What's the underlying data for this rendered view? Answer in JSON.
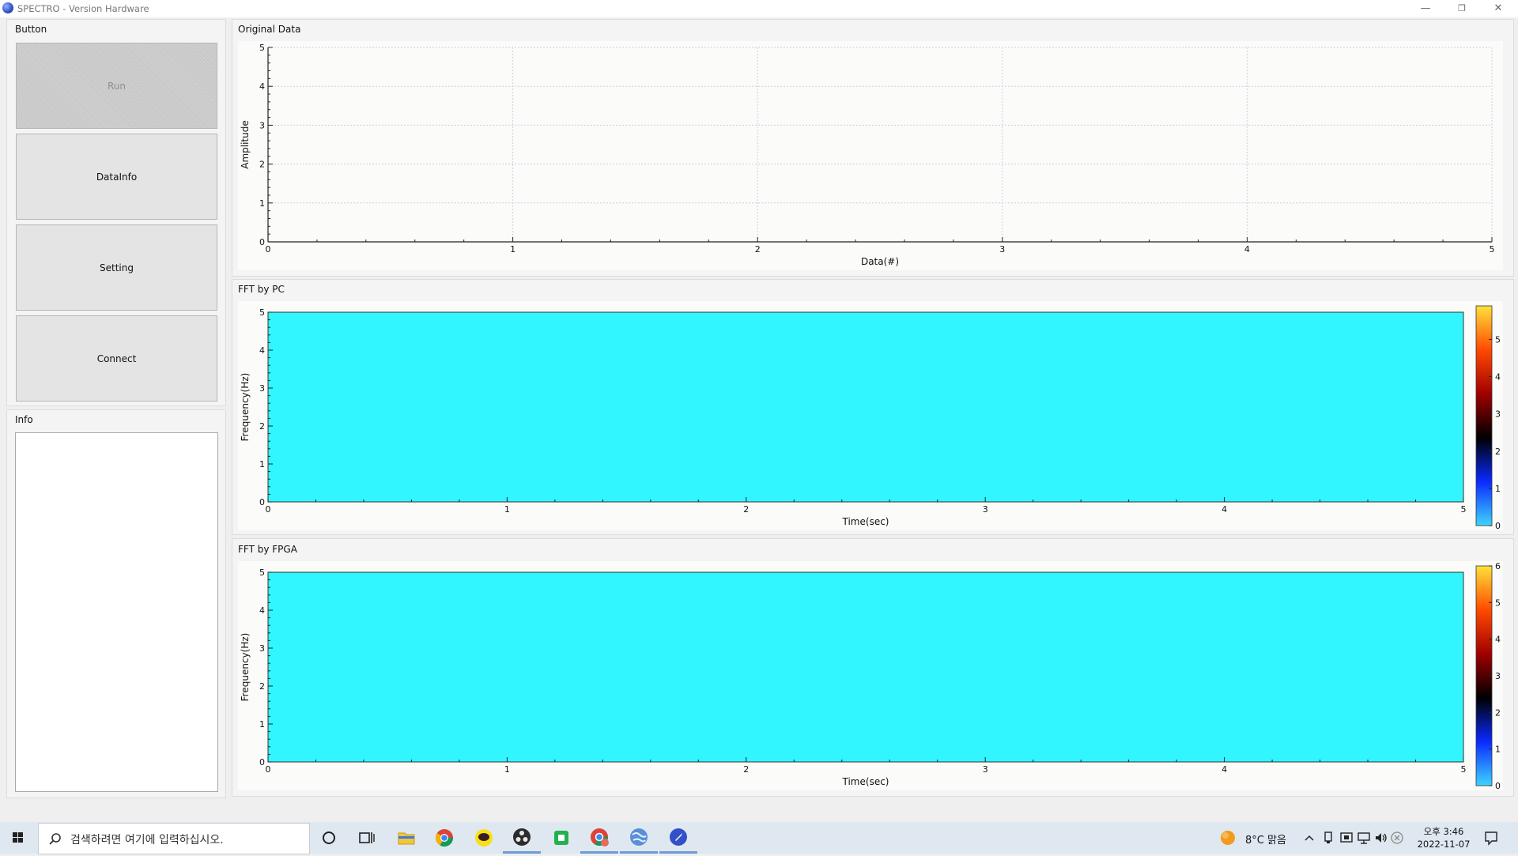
{
  "window": {
    "title": "SPECTRO - Version Hardware",
    "controls": {
      "minimize": "—",
      "restore": "❐",
      "close": "✕"
    }
  },
  "button_group": {
    "label": "Button",
    "buttons": [
      {
        "label": "Run",
        "enabled": false
      },
      {
        "label": "DataInfo",
        "enabled": true
      },
      {
        "label": "Setting",
        "enabled": true
      },
      {
        "label": "Connect",
        "enabled": true
      }
    ]
  },
  "info_group": {
    "label": "Info",
    "text": ""
  },
  "plots": [
    {
      "label": "Original Data",
      "chart_data": {
        "type": "line",
        "title": "",
        "xlabel": "Data(#)",
        "ylabel": "Amplitude",
        "xlim": [
          0,
          5
        ],
        "ylim": [
          0,
          5
        ],
        "x_ticks": [
          "0",
          "1",
          "2",
          "3",
          "4",
          "5"
        ],
        "y_ticks": [
          "0",
          "1",
          "2",
          "3",
          "4",
          "5"
        ],
        "grid": true,
        "series": []
      }
    },
    {
      "label": "FFT by PC",
      "chart_data": {
        "type": "heatmap",
        "title": "",
        "xlabel": "Time(sec)",
        "ylabel": "Frequency(Hz)",
        "xlim": [
          0,
          5
        ],
        "ylim": [
          0,
          5
        ],
        "x_ticks": [
          "0",
          "1",
          "2",
          "3",
          "4",
          "5"
        ],
        "y_ticks": [
          "0",
          "1",
          "2",
          "3",
          "4",
          "5"
        ],
        "fill_color": "#31f5ff",
        "colorbar": {
          "ticks": [
            "0",
            "1",
            "2",
            "3",
            "4",
            "5"
          ],
          "range": [
            0,
            5.9
          ],
          "colors": [
            "#3fd4ff",
            "#0a2aff",
            "#000000",
            "#a00000",
            "#ff4a00",
            "#ffe23a"
          ]
        }
      }
    },
    {
      "label": "FFT by FPGA",
      "chart_data": {
        "type": "heatmap",
        "title": "",
        "xlabel": "Time(sec)",
        "ylabel": "Frequency(Hz)",
        "xlim": [
          0,
          5
        ],
        "ylim": [
          0,
          5
        ],
        "x_ticks": [
          "0",
          "1",
          "2",
          "3",
          "4",
          "5"
        ],
        "y_ticks": [
          "0",
          "1",
          "2",
          "3",
          "4",
          "5"
        ],
        "fill_color": "#31f5ff",
        "colorbar": {
          "ticks": [
            "0",
            "1",
            "2",
            "3",
            "4",
            "5",
            "6"
          ],
          "range": [
            0,
            6
          ],
          "colors": [
            "#3fd4ff",
            "#0a2aff",
            "#000000",
            "#a00000",
            "#ff4a00",
            "#ffe23a"
          ]
        }
      }
    }
  ],
  "taskbar": {
    "search_placeholder": "검색하려면 여기에 입력하십시오.",
    "apps": [
      "cortana",
      "task-view",
      "file-explorer",
      "chrome",
      "kakaotalk",
      "obs",
      "line-app",
      "chrome-profile",
      "globe-app",
      "rocket-app"
    ],
    "weather": "8°C  맑음",
    "clock_time": "오후 3:46",
    "clock_date": "2022-11-07"
  }
}
